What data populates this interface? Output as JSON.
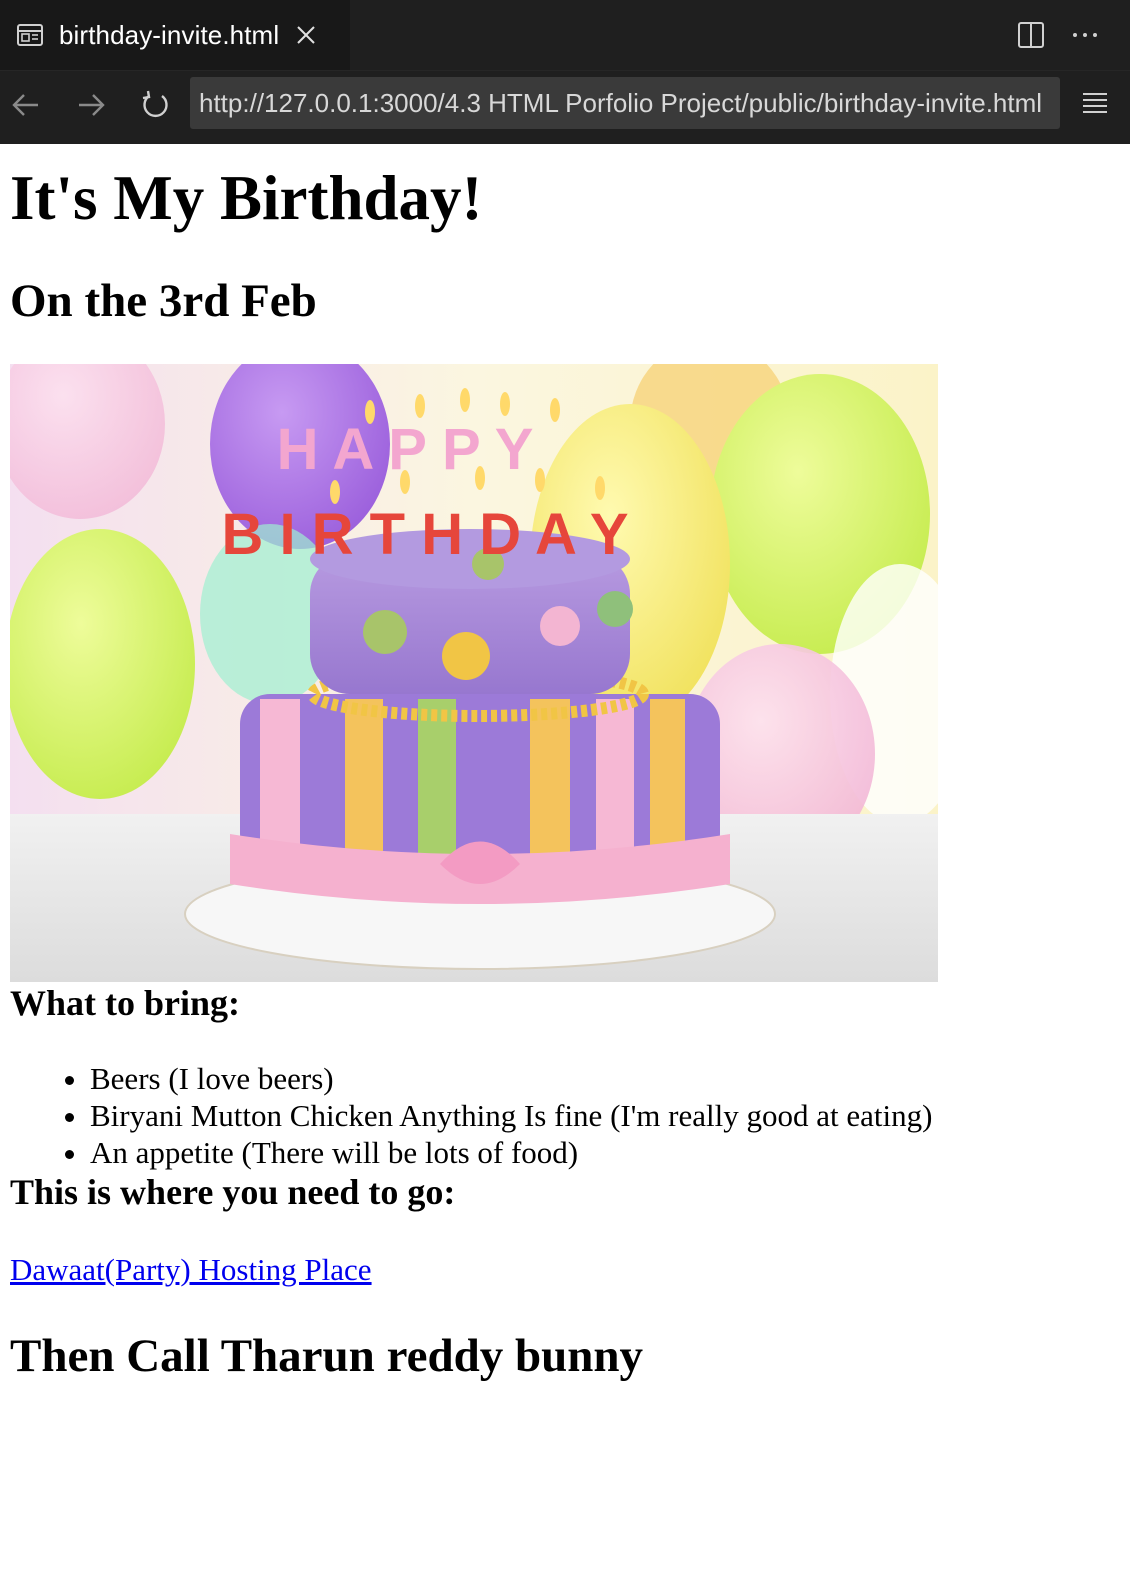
{
  "browser": {
    "tab_title": "birthday-invite.html",
    "url": "http://127.0.0.1:3000/4.3 HTML Porfolio Project/public/birthday-invite.html",
    "icons": [
      "page-icon",
      "close-icon",
      "split-editor-icon",
      "more-icon",
      "back-arrow-icon",
      "forward-arrow-icon",
      "reload-icon",
      "menu-icon"
    ]
  },
  "page": {
    "title": "It's My Birthday!",
    "date": "On the 3rd Feb",
    "image": {
      "cake_letters_top": "HAPPY",
      "cake_letters_bottom": "BIRTHDAY"
    },
    "bring_heading": "What to bring:",
    "bring_items": [
      "Beers (I love beers)",
      "Biryani Mutton Chicken Anything Is fine (I'm really good at eating)",
      "An appetite (There will be lots of food)"
    ],
    "where_heading": "This is where you need to go:",
    "venue_link": "Dawaat(Party) Hosting Place",
    "call_heading": "Then Call Tharun reddy bunny"
  },
  "colors": {
    "chrome_bg": "#1f1f1f",
    "url_bg": "#3a3a3a",
    "link": "#0000ee"
  }
}
